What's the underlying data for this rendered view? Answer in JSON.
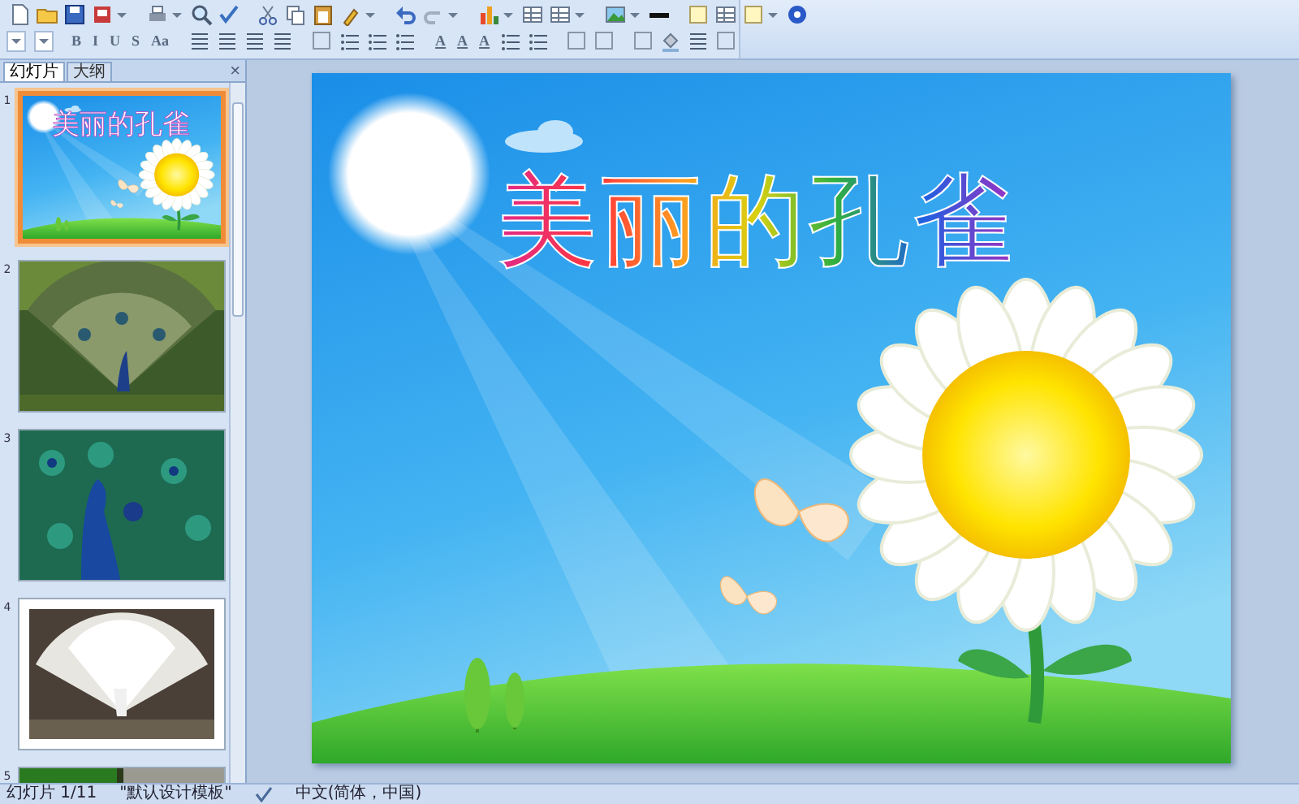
{
  "toolbar": {
    "format_buttons": [
      "B",
      "I",
      "U",
      "S",
      "Aa"
    ],
    "color_buttons": [
      "A",
      "A",
      "A"
    ]
  },
  "panel": {
    "tabs": [
      {
        "label": "幻灯片",
        "selected": true
      },
      {
        "label": "大纲",
        "selected": false
      }
    ],
    "close": "×"
  },
  "slides": [
    {
      "number": "1",
      "selected": true,
      "kind": "title",
      "title": "美丽的孔雀"
    },
    {
      "number": "2",
      "selected": false,
      "kind": "picture"
    },
    {
      "number": "3",
      "selected": false,
      "kind": "picture"
    },
    {
      "number": "4",
      "selected": false,
      "kind": "picture"
    },
    {
      "number": "5",
      "selected": false,
      "kind": "picture"
    }
  ],
  "slide": {
    "title": "美丽的孔雀"
  },
  "status_bar": {
    "slide_count": "幻灯片 1/11",
    "template": "\"默认设计模板\"",
    "language": "中文(简体，中国)"
  }
}
